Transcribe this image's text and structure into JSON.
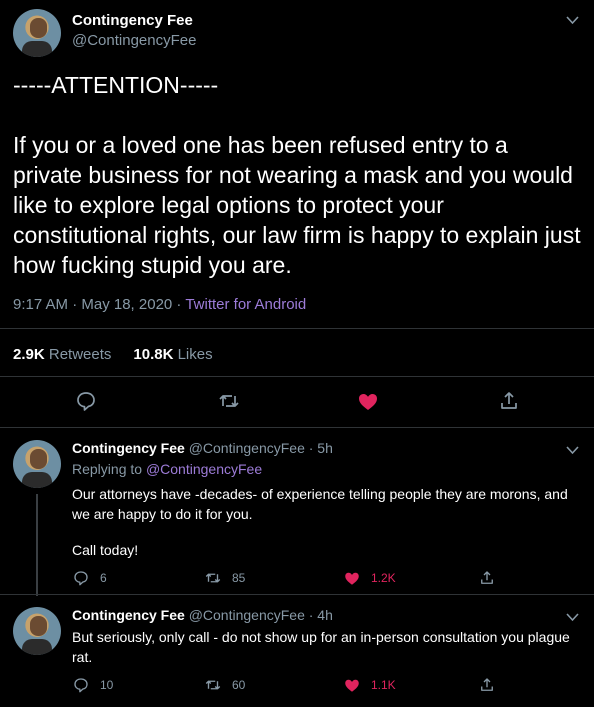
{
  "main": {
    "name": "Contingency Fee",
    "handle": "@ContingencyFee",
    "headline": "-----ATTENTION-----",
    "body": "If you or a loved one has been refused entry to a private business for not wearing a mask and you would like to explore legal options to protect your constitutional rights, our law firm is happy to explain just how fucking stupid you are.",
    "time": "9:17 AM · May 18, 2020 · ",
    "source": "Twitter for Android",
    "retweets_count": "2.9K",
    "retweets_label": "Retweets",
    "likes_count": "10.8K",
    "likes_label": "Likes"
  },
  "replies": [
    {
      "name": "Contingency Fee",
      "meta": "@ContingencyFee · 5h",
      "replying_label": "Replying to ",
      "replying_to": "@ContingencyFee",
      "text1": "Our attorneys have -decades- of experience telling people they are morons, and we are happy to do it for you.",
      "text2": "Call today!",
      "replies": "6",
      "retweets": "85",
      "likes": "1.2K"
    },
    {
      "name": "Contingency Fee",
      "meta": "@ContingencyFee · 4h",
      "text1": "But seriously, only call - do not show up for an in-person consultation you plague rat.",
      "replies": "10",
      "retweets": "60",
      "likes": "1.1K"
    }
  ],
  "colors": {
    "background": "#000000",
    "accent": "#9d7cd8",
    "like": "#e0245e",
    "muted": "#8899a6"
  }
}
